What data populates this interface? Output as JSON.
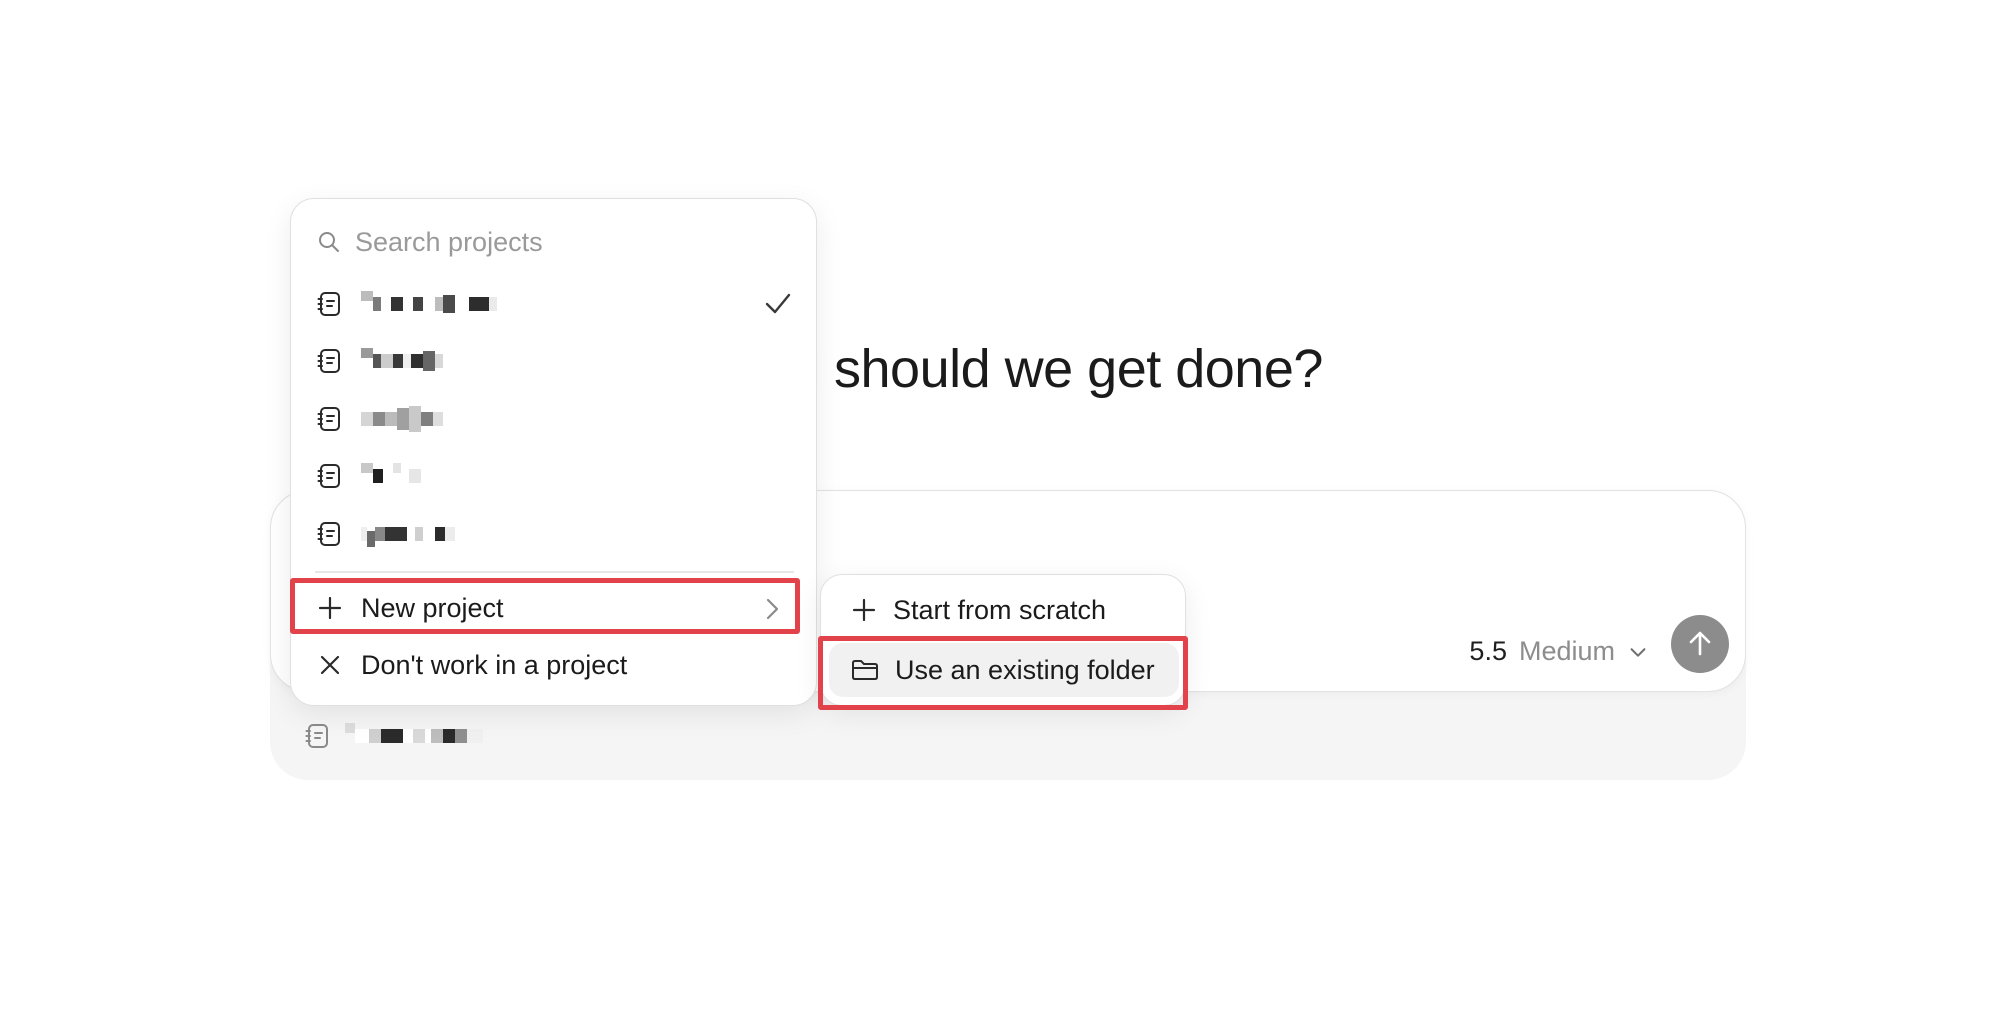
{
  "headline": {
    "text": "should we get done?"
  },
  "composer": {
    "model_version": "5.5",
    "model_effort": "Medium",
    "send_icon": "arrow-up-icon",
    "chevron_icon": "chevron-down-icon"
  },
  "project_menu": {
    "search_placeholder": "Search projects",
    "items_note_icon": "notebook-icon",
    "new_project_label": "New project",
    "no_project_label": "Don't work in a project"
  },
  "submenu": {
    "start_from_scratch_label": "Start from scratch",
    "use_existing_folder_label": "Use an existing folder"
  },
  "colors": {
    "highlight": "#e2424a",
    "send_button": "#8c8c8c",
    "muted_text": "#8d8d8d"
  }
}
